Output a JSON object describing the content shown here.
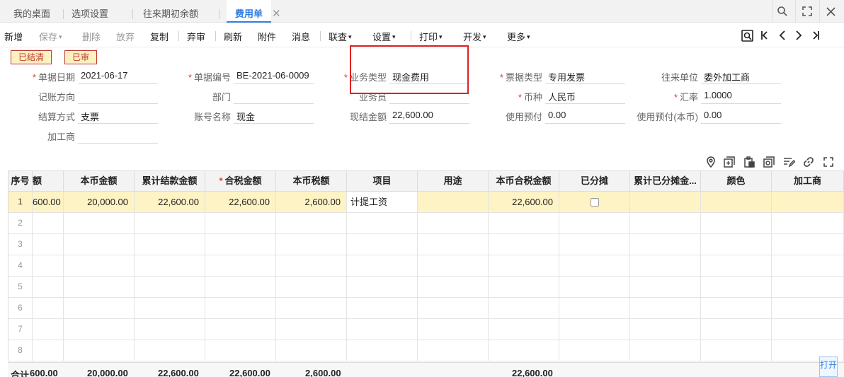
{
  "tabs": [
    {
      "label": "我的桌面"
    },
    {
      "label": "选项设置"
    },
    {
      "label": "往来期初余额"
    },
    {
      "label": "费用单"
    }
  ],
  "toolbar": {
    "items": [
      "新增",
      "保存",
      "删除",
      "放弃",
      "复制",
      "弃审",
      "刷新",
      "附件",
      "消息",
      "联查",
      "设置",
      "打印",
      "开发",
      "更多"
    ]
  },
  "status": {
    "settled": "已结清",
    "audited": "已审"
  },
  "form": {
    "date_label": "单据日期",
    "date_value": "2021-06-17",
    "no_label": "单据编号",
    "no_value": "BE-2021-06-0009",
    "biztype_label": "业务类型",
    "biztype_value": "现金费用",
    "billtype_label": "票据类型",
    "billtype_value": "专用发票",
    "partner_label": "往来单位",
    "partner_value": "委外加工商",
    "direction_label": "记账方向",
    "direction_value": "",
    "dept_label": "部门",
    "dept_value": "",
    "staff_label": "业务员",
    "staff_value": "",
    "currency_label": "币种",
    "currency_value": "人民币",
    "rate_label": "汇率",
    "rate_value": "1.0000",
    "settle_label": "结算方式",
    "settle_value": "支票",
    "account_label": "账号名称",
    "account_value": "现金",
    "cash_label": "现结金额",
    "cash_value": "22,600.00",
    "prepay_label": "使用预付",
    "prepay_value": "0.00",
    "prepay_local_label": "使用预付(本币)",
    "prepay_local_value": "0.00",
    "processor_label": "加工商",
    "processor_value": ""
  },
  "grid": {
    "headers": [
      "序号",
      "额",
      "本币金额",
      "累计结款金额",
      "合税金额",
      "本币税额",
      "项目",
      "用途",
      "本币合税金额",
      "已分摊",
      "累计已分摊金...",
      "颜色",
      "加工商"
    ],
    "row1": {
      "no": "1",
      "amount": "600.00",
      "local_amount": "20,000.00",
      "settled": "22,600.00",
      "tax_incl": "22,600.00",
      "local_tax": "2,600.00",
      "item": "计提工资",
      "use": "",
      "local_tax_incl": "22,600.00"
    },
    "empty_rows": [
      "2",
      "3",
      "4",
      "5",
      "6",
      "7",
      "8"
    ]
  },
  "footer": {
    "label": "合计",
    "amount": "600.00",
    "local_amount": "20,000.00",
    "settled": "22,600.00",
    "tax_incl": "22,600.00",
    "local_tax": "2,600.00",
    "local_tax_incl": "22,600.00"
  },
  "float_button": "打开"
}
